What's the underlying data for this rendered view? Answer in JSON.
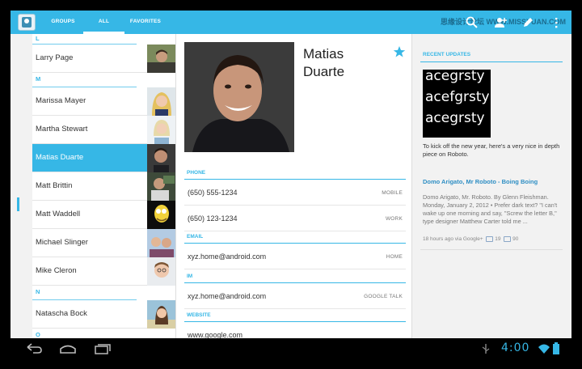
{
  "watermark": "思缘设计论坛  WWW.MISSYUAN.COM",
  "tabs": [
    {
      "label": "GROUPS",
      "active": false
    },
    {
      "label": "ALL",
      "active": true
    },
    {
      "label": "FAVORITES",
      "active": false
    }
  ],
  "actionbar_icons": [
    "search-icon",
    "add-contact-icon",
    "edit-icon",
    "overflow-menu-icon"
  ],
  "contacts": {
    "header_l": "L",
    "header_m": "M",
    "header_n": "N",
    "header_o": "O",
    "rows": [
      {
        "name": "Larry Page"
      },
      {
        "name": "Marissa Mayer"
      },
      {
        "name": "Martha Stewart"
      },
      {
        "name": "Matias Duarte",
        "selected": true
      },
      {
        "name": "Matt Brittin"
      },
      {
        "name": "Matt Waddell"
      },
      {
        "name": "Michael Slinger"
      },
      {
        "name": "Mike Cleron"
      },
      {
        "name": "Natascha Bock"
      }
    ]
  },
  "detail": {
    "name_line1": "Matias",
    "name_line2": "Duarte",
    "sections": {
      "phone": "PHONE",
      "email": "EMAIL",
      "im": "IM",
      "website": "WEBSITE"
    },
    "phone1": {
      "value": "(650) 555-1234",
      "type": "MOBILE"
    },
    "phone2": {
      "value": "(650) 123-1234",
      "type": "WORK"
    },
    "email1": {
      "value": "xyz.home@android.com",
      "type": "HOME"
    },
    "im1": {
      "value": "xyz.home@android.com",
      "type": "GOOGLE TALK"
    },
    "website1": {
      "value": "www.google.com"
    }
  },
  "updates": {
    "header": "RECENT UPDATES",
    "image_lines": [
      "acegrsty",
      "acefgrsty",
      "acegrsty"
    ],
    "text": "To kick off the new year, here's a very nice in depth piece on Roboto.",
    "link": "Domo Arigato, Mr Roboto - Boing Boing",
    "body": "Domo Arigato, Mr. Roboto. By Glenn Fleishman. Monday, January 2, 2012 • Prefer dark text? \"I can't wake up one morning and say, \"Screw the letter B,\" type designer Matthew Carter told me ...",
    "meta": "18 hours ago via Google+",
    "plus_count": "19",
    "share_count": "90"
  },
  "navbar": {
    "clock": "4:00",
    "icons": [
      "back-icon",
      "home-icon",
      "recent-apps-icon",
      "usb-icon",
      "wifi-icon",
      "battery-icon"
    ]
  },
  "colors": {
    "accent": "#36b7e6",
    "link": "#2f8fc4"
  }
}
